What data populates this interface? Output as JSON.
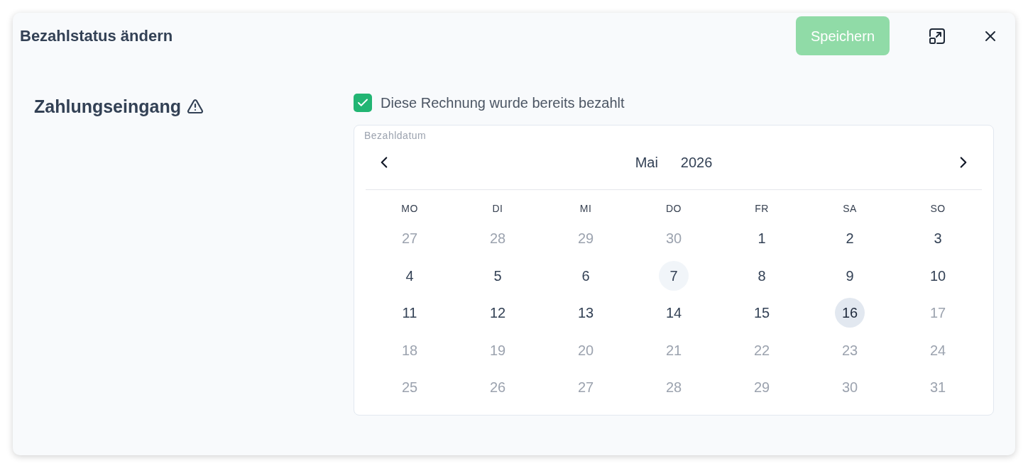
{
  "dialog": {
    "title": "Bezahlstatus ändern",
    "save_button": {
      "label": "Speichern",
      "disabled": true
    }
  },
  "payment": {
    "title": "Zahlungseingang",
    "paid_checkbox": {
      "label": "Diese Rechnung wurde bereits bezahlt",
      "checked": true
    },
    "date_picker": {
      "label": "Bezahldatum",
      "month": "Mai",
      "year": "2026",
      "weekdays": [
        "MO",
        "DI",
        "MI",
        "DO",
        "FR",
        "SA",
        "SO"
      ],
      "weeks": [
        {
          "days": [
            {
              "label": "27",
              "disabled": true,
              "today": false,
              "selected": false
            },
            {
              "label": "28",
              "disabled": true,
              "today": false,
              "selected": false
            },
            {
              "label": "29",
              "disabled": true,
              "today": false,
              "selected": false
            },
            {
              "label": "30",
              "disabled": true,
              "today": false,
              "selected": false
            },
            {
              "label": "1",
              "disabled": false,
              "today": false,
              "selected": false
            },
            {
              "label": "2",
              "disabled": false,
              "today": false,
              "selected": false
            },
            {
              "label": "3",
              "disabled": false,
              "today": false,
              "selected": false
            }
          ]
        },
        {
          "days": [
            {
              "label": "4",
              "disabled": false,
              "today": false,
              "selected": false
            },
            {
              "label": "5",
              "disabled": false,
              "today": false,
              "selected": false
            },
            {
              "label": "6",
              "disabled": false,
              "today": false,
              "selected": false
            },
            {
              "label": "7",
              "disabled": false,
              "today": true,
              "selected": false
            },
            {
              "label": "8",
              "disabled": false,
              "today": false,
              "selected": false
            },
            {
              "label": "9",
              "disabled": false,
              "today": false,
              "selected": false
            },
            {
              "label": "10",
              "disabled": false,
              "today": false,
              "selected": false
            }
          ]
        },
        {
          "days": [
            {
              "label": "11",
              "disabled": false,
              "today": false,
              "selected": false
            },
            {
              "label": "12",
              "disabled": false,
              "today": false,
              "selected": false
            },
            {
              "label": "13",
              "disabled": false,
              "today": false,
              "selected": false
            },
            {
              "label": "14",
              "disabled": false,
              "today": false,
              "selected": false
            },
            {
              "label": "15",
              "disabled": false,
              "today": false,
              "selected": false
            },
            {
              "label": "16",
              "disabled": false,
              "today": false,
              "selected": true
            },
            {
              "label": "17",
              "disabled": true,
              "today": false,
              "selected": false
            }
          ]
        },
        {
          "days": [
            {
              "label": "18",
              "disabled": true,
              "today": false,
              "selected": false
            },
            {
              "label": "19",
              "disabled": true,
              "today": false,
              "selected": false
            },
            {
              "label": "20",
              "disabled": true,
              "today": false,
              "selected": false
            },
            {
              "label": "21",
              "disabled": true,
              "today": false,
              "selected": false
            },
            {
              "label": "22",
              "disabled": true,
              "today": false,
              "selected": false
            },
            {
              "label": "23",
              "disabled": true,
              "today": false,
              "selected": false
            },
            {
              "label": "24",
              "disabled": true,
              "today": false,
              "selected": false
            }
          ]
        },
        {
          "days": [
            {
              "label": "25",
              "disabled": true,
              "today": false,
              "selected": false
            },
            {
              "label": "26",
              "disabled": true,
              "today": false,
              "selected": false
            },
            {
              "label": "27",
              "disabled": true,
              "today": false,
              "selected": false
            },
            {
              "label": "28",
              "disabled": true,
              "today": false,
              "selected": false
            },
            {
              "label": "29",
              "disabled": true,
              "today": false,
              "selected": false
            },
            {
              "label": "30",
              "disabled": true,
              "today": false,
              "selected": false
            },
            {
              "label": "31",
              "disabled": true,
              "today": false,
              "selected": false
            }
          ]
        }
      ]
    }
  }
}
